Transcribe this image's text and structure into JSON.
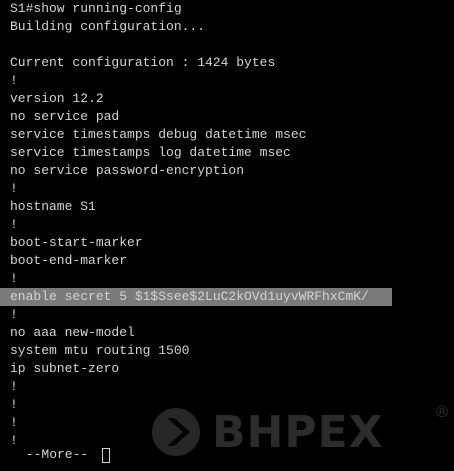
{
  "terminal": {
    "lines": [
      "S1#show running-config",
      "Building configuration...",
      "",
      "Current configuration : 1424 bytes",
      "!",
      "version 12.2",
      "no service pad",
      "service timestamps debug datetime msec",
      "service timestamps log datetime msec",
      "no service password-encryption",
      "!",
      "hostname S1",
      "!",
      "boot-start-marker",
      "boot-end-marker",
      "!",
      "enable secret 5 $1$Ssee$2LuC2kOVd1uyvWRFhxCmK/",
      "!",
      "no aaa new-model",
      "system mtu routing 1500",
      "ip subnet-zero",
      "!",
      "!",
      "!",
      "!"
    ],
    "more_prompt": " --More-- "
  },
  "watermark": {
    "text": "BHPEX",
    "registered": "®"
  },
  "colors": {
    "background": "#000000",
    "text": "#d4d4d4",
    "highlight": "#7a7a7a"
  }
}
